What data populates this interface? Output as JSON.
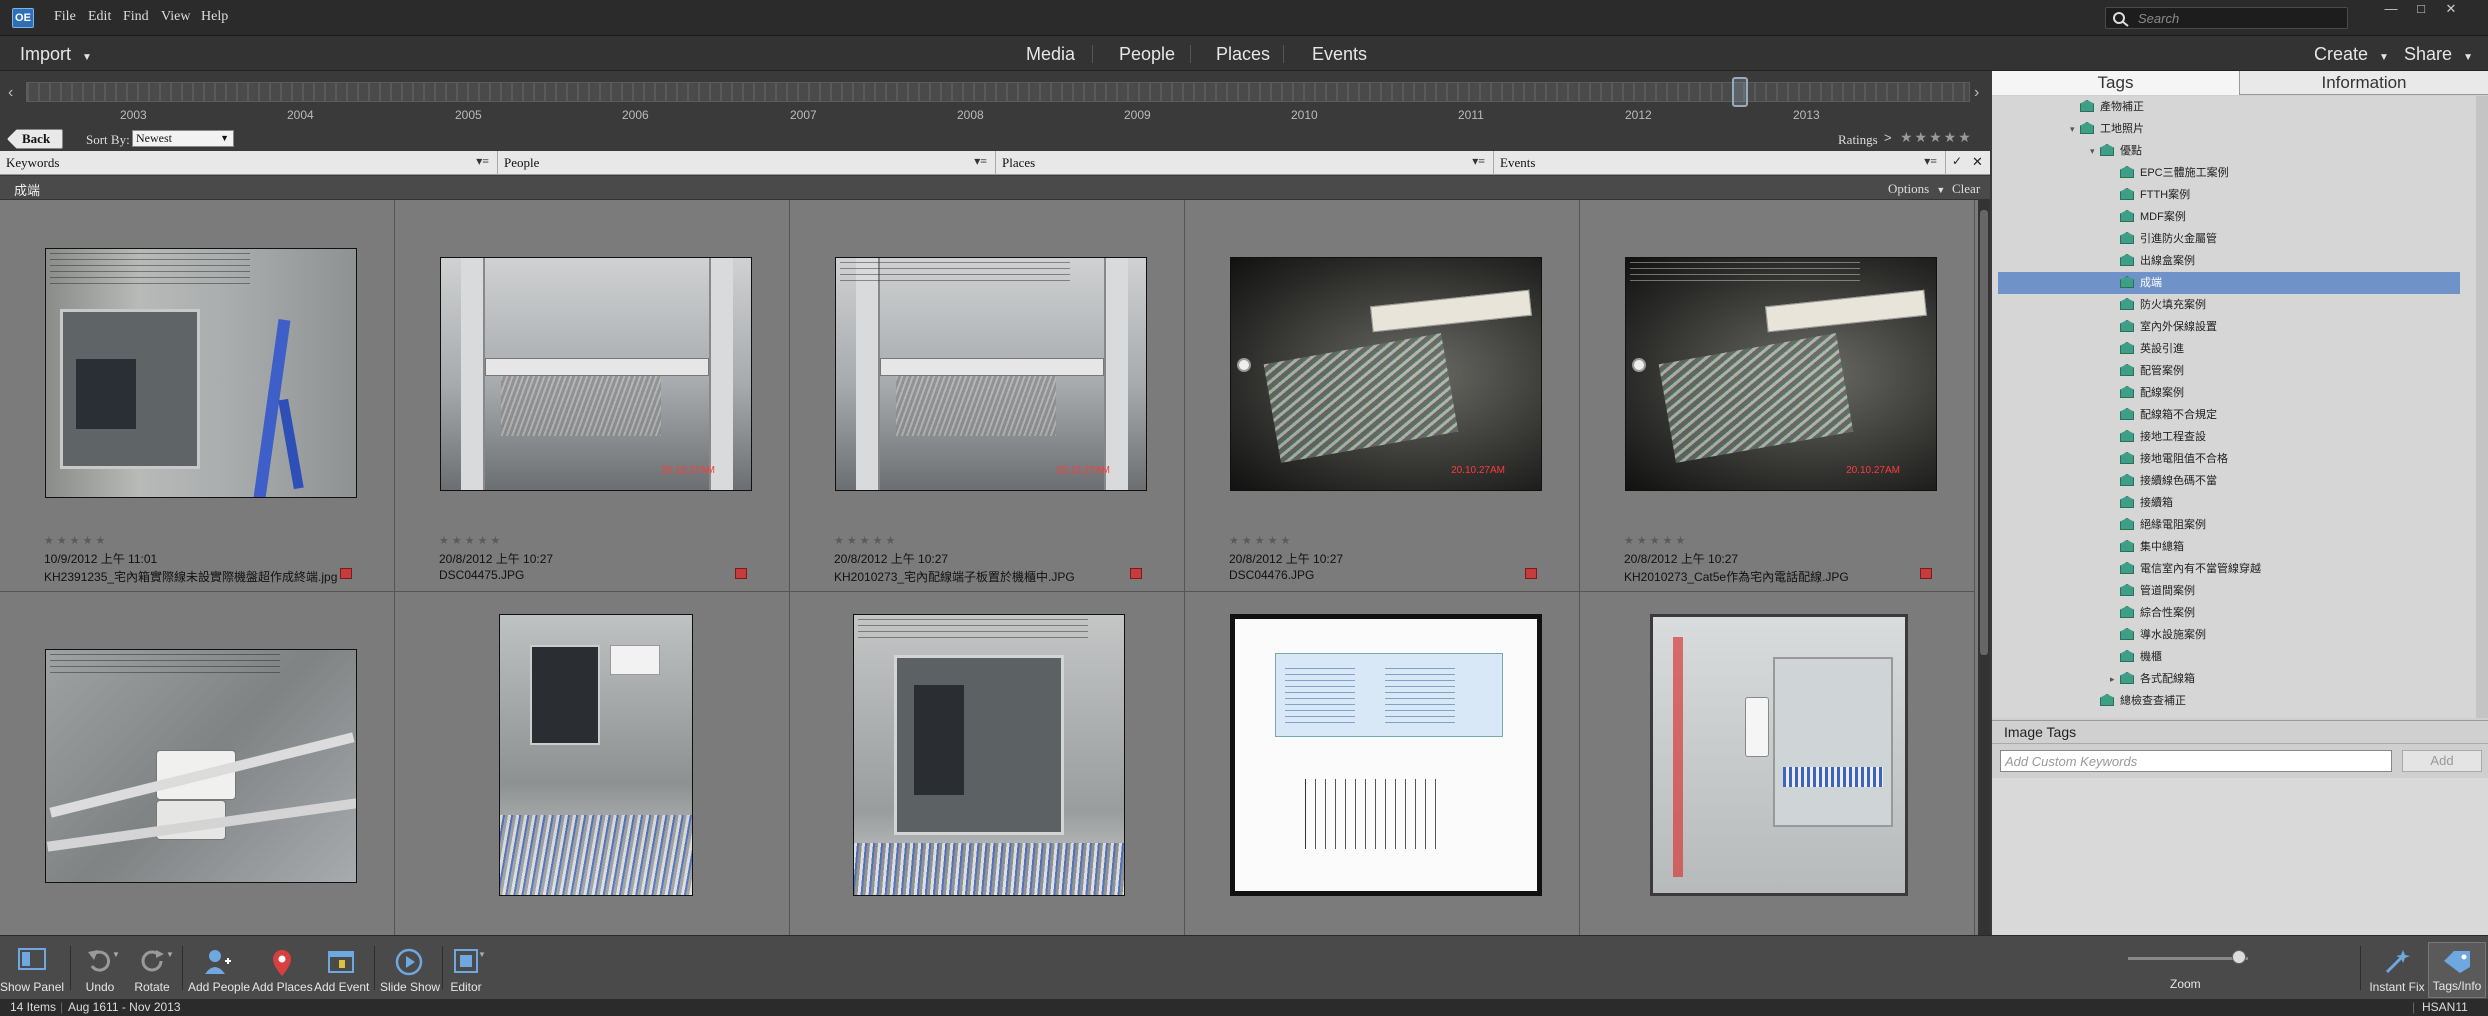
{
  "menubar": {
    "items": [
      "File",
      "Edit",
      "Find",
      "View",
      "Help"
    ],
    "search_placeholder": "Search"
  },
  "modebar": {
    "import_label": "Import",
    "tabs": [
      "Media",
      "People",
      "Places",
      "Events"
    ],
    "create_label": "Create",
    "share_label": "Share"
  },
  "timeline": {
    "years": [
      "2003",
      "2004",
      "2005",
      "2006",
      "2007",
      "2008",
      "2009",
      "2010",
      "2011",
      "2012",
      "2013"
    ]
  },
  "backrow": {
    "back_label": "Back",
    "sort_label": "Sort By:",
    "sort_value": "Newest",
    "ratings_label": "Ratings",
    "ratings_stars": "★★★★★"
  },
  "filters": [
    {
      "label": "Keywords"
    },
    {
      "label": "People"
    },
    {
      "label": "Places"
    },
    {
      "label": "Events"
    }
  ],
  "crumbbar": {
    "title": "成端",
    "options": "Options",
    "clear": "Clear"
  },
  "photos": [
    {
      "date": "10/9/2012 上午 11:01",
      "name": "KH2391235_宅內箱實際線未設實際機盤超作成終端.jpg",
      "stars": "★★★★★",
      "stamp": ""
    },
    {
      "date": "20/8/2012 上午 10:27",
      "name": "DSC04475.JPG",
      "stars": "★★★★★",
      "stamp": "20.10.27AM"
    },
    {
      "date": "20/8/2012 上午 10:27",
      "name": "KH2010273_宅內配線端子板置於機櫃中.JPG",
      "stars": "★★★★★",
      "stamp": "20.10.27AM"
    },
    {
      "date": "20/8/2012 上午 10:27",
      "name": "DSC04476.JPG",
      "stars": "★★★★★",
      "stamp": "20.10.27AM"
    },
    {
      "date": "20/8/2012 上午 10:27",
      "name": "KH2010273_Cat5e作為宅內電話配線.JPG",
      "stars": "★★★★★",
      "stamp": "20.10.27AM"
    },
    {
      "stars": "★★★★★"
    },
    {
      "stars": "★★★★★"
    },
    {
      "stars": "★★★★★"
    },
    {
      "stars": "★★★★★"
    },
    {
      "stars": "★★★★★"
    }
  ],
  "tags": {
    "tab_tags": "Tags",
    "tab_info": "Information",
    "tree": [
      {
        "label": "產物補正",
        "level": 4,
        "tri": ""
      },
      {
        "label": "工地照片",
        "level": 4,
        "tri": "▾"
      },
      {
        "label": "優點",
        "level": 5,
        "tri": "▾"
      },
      {
        "label": "EPC三體施工案例",
        "level": 6,
        "tri": ""
      },
      {
        "label": "FTTH案例",
        "level": 6,
        "tri": ""
      },
      {
        "label": "MDF案例",
        "level": 6,
        "tri": ""
      },
      {
        "label": "引進防火金屬管",
        "level": 6,
        "tri": ""
      },
      {
        "label": "出線盒案例",
        "level": 6,
        "tri": ""
      },
      {
        "label": "成端",
        "level": 6,
        "tri": "",
        "selected": true
      },
      {
        "label": "防火填充案例",
        "level": 6,
        "tri": ""
      },
      {
        "label": "室內外保線設置",
        "level": 6,
        "tri": ""
      },
      {
        "label": "英設引進",
        "level": 6,
        "tri": ""
      },
      {
        "label": "配管案例",
        "level": 6,
        "tri": ""
      },
      {
        "label": "配線案例",
        "level": 6,
        "tri": ""
      },
      {
        "label": "配線箱不合規定",
        "level": 6,
        "tri": ""
      },
      {
        "label": "接地工程查設",
        "level": 6,
        "tri": ""
      },
      {
        "label": "接地電阻值不合格",
        "level": 6,
        "tri": ""
      },
      {
        "label": "接續線色碼不當",
        "level": 6,
        "tri": ""
      },
      {
        "label": "接續箱",
        "level": 6,
        "tri": ""
      },
      {
        "label": "絕緣電阻案例",
        "level": 6,
        "tri": ""
      },
      {
        "label": "集中總箱",
        "level": 6,
        "tri": ""
      },
      {
        "label": "電信室內有不當管線穿越",
        "level": 6,
        "tri": ""
      },
      {
        "label": "管道間案例",
        "level": 6,
        "tri": ""
      },
      {
        "label": "綜合性案例",
        "level": 6,
        "tri": ""
      },
      {
        "label": "導水設施案例",
        "level": 6,
        "tri": ""
      },
      {
        "label": "機櫃",
        "level": 6,
        "tri": ""
      },
      {
        "label": "各式配線箱",
        "level": 6,
        "tri": "▸"
      },
      {
        "label": "總檢查查補正",
        "level": 5,
        "tri": ""
      }
    ],
    "image_tags_label": "Image Tags",
    "custom_placeholder": "Add Custom Keywords",
    "add_label": "Add"
  },
  "toolbar": {
    "show_panel": "Show Panel",
    "undo": "Undo",
    "rotate": "Rotate",
    "add_people": "Add People",
    "add_places": "Add Places",
    "add_event": "Add Event",
    "slide_show": "Slide Show",
    "editor": "Editor",
    "zoom": "Zoom",
    "instant_fix": "Instant Fix",
    "tags_info": "Tags/Info"
  },
  "status": {
    "count": "14 Items",
    "range": "Aug 1611 - Nov 2013",
    "user": "HSAN11"
  },
  "colors": {
    "accent_selection": "#6f93c8",
    "tag_icon": "#3e9f86",
    "grid_bg": "#7b7b7b",
    "timestamp_red": "#ff3a3a"
  }
}
